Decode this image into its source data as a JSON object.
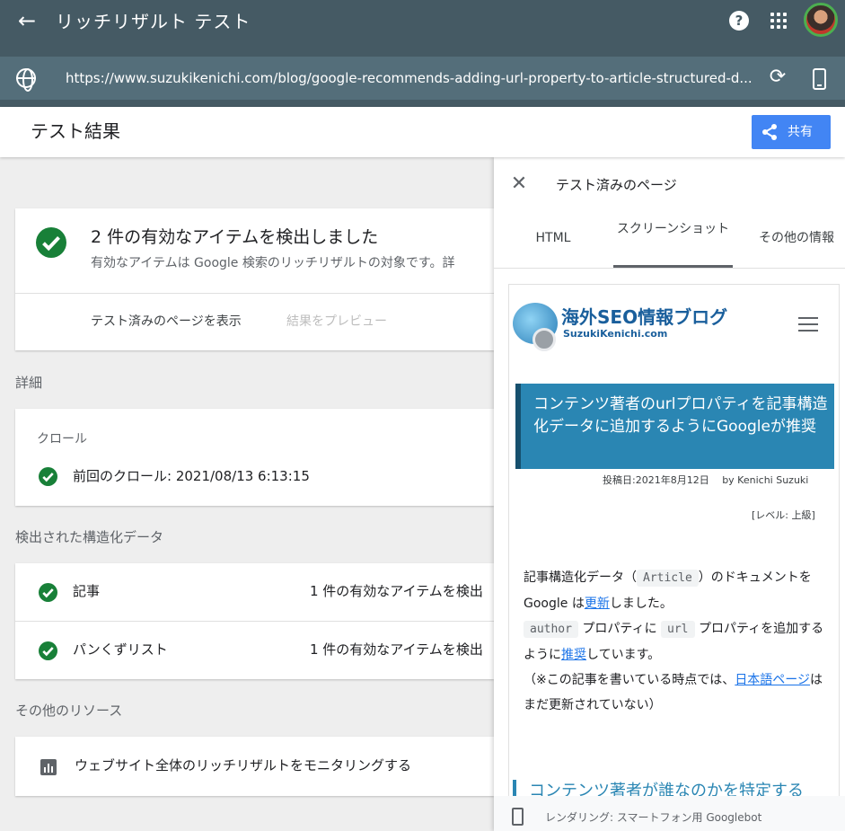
{
  "appbar": {
    "title": "リッチリザルト テスト",
    "url": "https://www.suzukikenichi.com/blog/google-recommends-adding-url-property-to-article-structured-d..."
  },
  "header": {
    "title": "テスト結果",
    "share_label": "共有"
  },
  "summary": {
    "title": "2 件の有効なアイテムを検出しました",
    "subtitle": "有効なアイテムは Google 検索のリッチリザルトの対象です。詳",
    "view_page": "テスト済みのページを表示",
    "preview": "結果をプレビュー"
  },
  "details": {
    "label": "詳細",
    "crawl_heading": "クロール",
    "last_crawl": "前回のクロール: 2021/08/13 6:13:15"
  },
  "structured": {
    "label": "検出された構造化データ",
    "rows": [
      {
        "name": "記事",
        "status": "1 件の有効なアイテムを検出"
      },
      {
        "name": "パンくずリスト",
        "status": "1 件の有効なアイテムを検出"
      }
    ]
  },
  "resources": {
    "label": "その他のリソース",
    "monitor": "ウェブサイト全体のリッチリザルトをモニタリングする"
  },
  "panel": {
    "title": "テスト済みのページ",
    "tabs": [
      "HTML",
      "スクリーンショット",
      "その他の情報"
    ],
    "active_tab": "スクリーンショット",
    "render_info": "レンダリング: スマートフォン用 Googlebot"
  },
  "screenshot": {
    "logo_main": "海外SEO情報ブログ",
    "logo_sub": "SuzukiKenichi.com",
    "headline": "コンテンツ著者のurlプロパティを記事構造化データに追加するようにGoogleが推奨",
    "post_date": "投稿日:2021年8月12日　 by Kenichi Suzuki",
    "level": "[レベル: 上級]",
    "body": {
      "p1_a": "記事構造化データ（",
      "code_article": "Article",
      "p1_b": "）のドキュメントを Google は",
      "link_update": "更新",
      "p1_c": "しました。",
      "code_author": "author",
      "p2_a": " プロパティに ",
      "code_url": "url",
      "p2_b": " プロパティを追加するように",
      "link_recommend": "推奨",
      "p2_c": "しています。",
      "p3_a": "（※この記事を書いている時点では、",
      "link_jp": "日本語ページ",
      "p3_b": "はまだ更新されていない）"
    },
    "heading2": "コンテンツ著者が誰なのかを特定する"
  },
  "colors": {
    "appbar": "#455a64",
    "urlbar": "#546e7a",
    "accent": "#4285f4",
    "success": "#188038",
    "banner": "#2a86b3"
  }
}
